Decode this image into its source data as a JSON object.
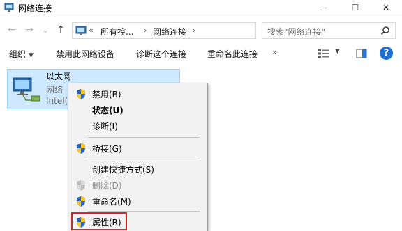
{
  "window": {
    "title": "网络连接",
    "minimize_symbol": "—",
    "maximize_symbol": "☐",
    "close_symbol": "✕"
  },
  "navigation": {
    "back_symbol": "←",
    "forward_symbol": "→",
    "recent_symbol": "⌄",
    "up_symbol": "↑",
    "breadcrumb_overflow": "«",
    "breadcrumb_sep": "›",
    "breadcrumb": [
      "所有控...",
      "网络连接"
    ],
    "dropdown_symbol": "⌄",
    "refresh_symbol": "↻",
    "search_placeholder": "搜索\"网络连接\""
  },
  "toolbar": {
    "organize": "组织",
    "disable_device": "禁用此网络设备",
    "diagnose": "诊断这个连接",
    "rename": "重命名此连接",
    "more": "»",
    "help_symbol": "?"
  },
  "connection": {
    "name": "以太网",
    "status": "网络",
    "device": "Intel(R"
  },
  "context_menu": {
    "items": [
      {
        "label": "禁用(B)",
        "shield": true,
        "bold": false,
        "disabled": false
      },
      {
        "label": "状态(U)",
        "shield": false,
        "bold": true,
        "disabled": false
      },
      {
        "label": "诊断(I)",
        "shield": false,
        "bold": false,
        "disabled": false
      },
      {
        "label": "桥接(G)",
        "shield": true,
        "bold": false,
        "disabled": false
      },
      {
        "label": "创建快捷方式(S)",
        "shield": false,
        "bold": false,
        "disabled": false
      },
      {
        "label": "删除(D)",
        "shield": true,
        "bold": false,
        "disabled": true
      },
      {
        "label": "重命名(M)",
        "shield": true,
        "bold": false,
        "disabled": false
      },
      {
        "label": "属性(R)",
        "shield": true,
        "bold": false,
        "disabled": false
      }
    ]
  },
  "colors": {
    "selection_bg": "#cde8ff",
    "highlight_border": "#d6262a",
    "help_blue": "#1e6fd0"
  }
}
